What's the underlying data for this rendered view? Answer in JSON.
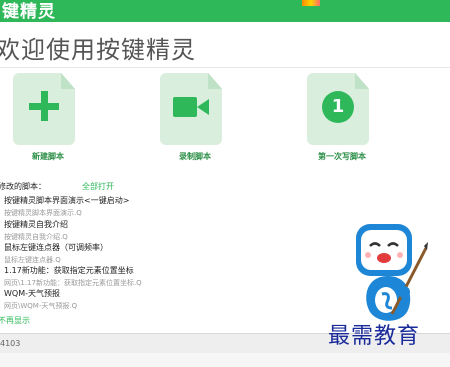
{
  "app": {
    "title": "键精灵"
  },
  "welcome": "欢迎使用按键精灵",
  "actions": [
    {
      "label": "新建脚本",
      "icon": "plus-icon"
    },
    {
      "label": "录制脚本",
      "icon": "video-camera-icon"
    },
    {
      "label": "第一次写脚本",
      "icon": "number-one-icon",
      "icon_text": "1"
    }
  ],
  "recent": {
    "heading": "修改的脚本：",
    "open_all": "全部打开",
    "items": [
      {
        "name": "按键精灵脚本界面演示<一键启动>",
        "desc": "按键精灵脚本界面演示.Q"
      },
      {
        "name": "按键精灵自我介绍",
        "desc": "按键精灵自我介绍.Q"
      },
      {
        "name": "鼠标左键连点器（可调频率）",
        "desc": "鼠标左键连点器.Q"
      },
      {
        "name": "1.17新功能：获取指定元素位置坐标",
        "desc": "网页\\1.17新功能：获取指定元素位置坐标.Q"
      },
      {
        "name": "WQM-天气预报",
        "desc": "网页\\WQM-天气预报.Q"
      }
    ],
    "no_show": "不再显示"
  },
  "footer": {
    "version": "4103"
  },
  "watermark": "最需教育",
  "colors": {
    "accent": "#2fb85a",
    "card_bg": "#d9eedc"
  }
}
